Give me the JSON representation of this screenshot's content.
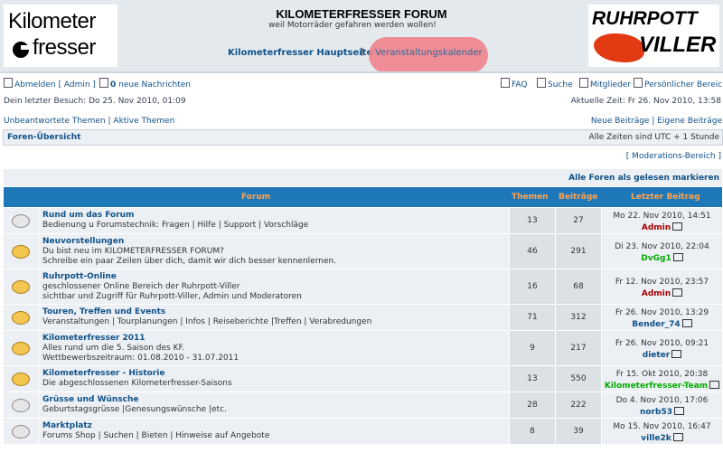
{
  "header": {
    "logo_left_line1": "Kilometer",
    "logo_left_line2": "fresser",
    "title": "KILOMETERFRESSER FORUM",
    "description": "weil Motorräder gefahren werden wollen!",
    "nav_home": "Kilometerfresser Hauptseite",
    "nav_sep": "|",
    "nav_calendar": "Veranstaltungskalender",
    "logo_right_line1": "RUHRPOTT",
    "logo_right_line2": "VILLER",
    "highlight_color": "#f07d87"
  },
  "userbar": {
    "logout": "Abmelden [ Admin ]",
    "messages_count": "0",
    "messages_label": "neue Nachrichten",
    "faq": "FAQ",
    "search": "Suche",
    "members": "Mitglieder",
    "personal": "Persönlicher Bereich",
    "last_visit": "Dein letzter Besuch: Do 25. Nov 2010, 01:09",
    "current_time": "Aktuelle Zeit: Fr 26. Nov 2010, 13:58"
  },
  "quicklinks": {
    "unanswered": "Unbeantwortete Themen",
    "sep": "|",
    "active": "Aktive Themen",
    "new_posts": "Neue Beiträge",
    "own_posts": "Eigene Beiträge"
  },
  "breadcrumb": {
    "label": "Foren-Übersicht",
    "timezone": "Alle Zeiten sind UTC + 1 Stunde"
  },
  "moderation": "[ Moderations-Bereich ]",
  "mark_all_read": "Alle Foren als gelesen markieren",
  "table": {
    "headers": {
      "forum": "Forum",
      "topics": "Themen",
      "posts": "Beiträge",
      "last": "Letzter Beitrag"
    },
    "rows": [
      {
        "name": "Rund um das Forum",
        "desc": [
          "Bedienung u Forumstechnik: Fragen | Hilfe | Support | Vorschläge"
        ],
        "topics": "13",
        "posts": "27",
        "date": "Mo 22. Nov 2010, 14:51",
        "user": "Admin",
        "user_color": "#aa0000",
        "new": false
      },
      {
        "name": "Neuvorstellungen",
        "desc": [
          "Du bist neu im KILOMETERFRESSER FORUM?",
          "Schreibe ein paar Zeilen über dich, damit wir dich besser kennenlernen."
        ],
        "topics": "46",
        "posts": "291",
        "date": "Di 23. Nov 2010, 22:04",
        "user": "DvGg1",
        "user_color": "#00aa00",
        "new": true
      },
      {
        "name": "Ruhrpott-Online",
        "desc": [
          "geschlossener Online Bereich der Ruhrpott-Viller",
          "sichtbar und Zugriff für Ruhrpott-Viller, Admin und Moderatoren"
        ],
        "topics": "16",
        "posts": "68",
        "date": "Fr 12. Nov 2010, 23:57",
        "user": "Admin",
        "user_color": "#aa0000",
        "new": true
      },
      {
        "name": "Touren, Treffen und Events",
        "desc": [
          "Veranstaltungen | Tourplanungen | Infos | Reiseberichte |Treffen | Verabredungen"
        ],
        "topics": "71",
        "posts": "312",
        "date": "Fr 26. Nov 2010, 13:29",
        "user": "Bender_74",
        "user_color": "#105289",
        "new": true
      },
      {
        "name": "Kilometerfresser 2011",
        "desc": [
          "Alles rund um die 5. Saison des KF.",
          "Wettbewerbszeitraum: 01.08.2010 - 31.07.2011"
        ],
        "topics": "9",
        "posts": "217",
        "date": "Fr 26. Nov 2010, 09:21",
        "user": "dieter",
        "user_color": "#105289",
        "new": true
      },
      {
        "name": "Kilometerfresser - Historie",
        "desc": [
          "Die abgeschlossenen Kilometerfresser-Saisons"
        ],
        "topics": "13",
        "posts": "550",
        "date": "Fr 15. Okt 2010, 20:38",
        "user": "Kilometerfresser-Team",
        "user_color": "#00aa00",
        "new": true
      },
      {
        "name": "Grüsse und Wünsche",
        "desc": [
          "Geburtstagsgrüsse |Genesungswünsche |etc."
        ],
        "topics": "28",
        "posts": "222",
        "date": "Do 4. Nov 2010, 17:06",
        "user": "norb53",
        "user_color": "#105289",
        "new": false
      },
      {
        "name": "Marktplatz",
        "desc": [
          "Forums Shop | Suchen | Bieten | Hinweise auf Angebote"
        ],
        "topics": "8",
        "posts": "39",
        "date": "Mo 15. Nov 2010, 16:47",
        "user": "ville2k",
        "user_color": "#105289",
        "new": false
      }
    ]
  }
}
